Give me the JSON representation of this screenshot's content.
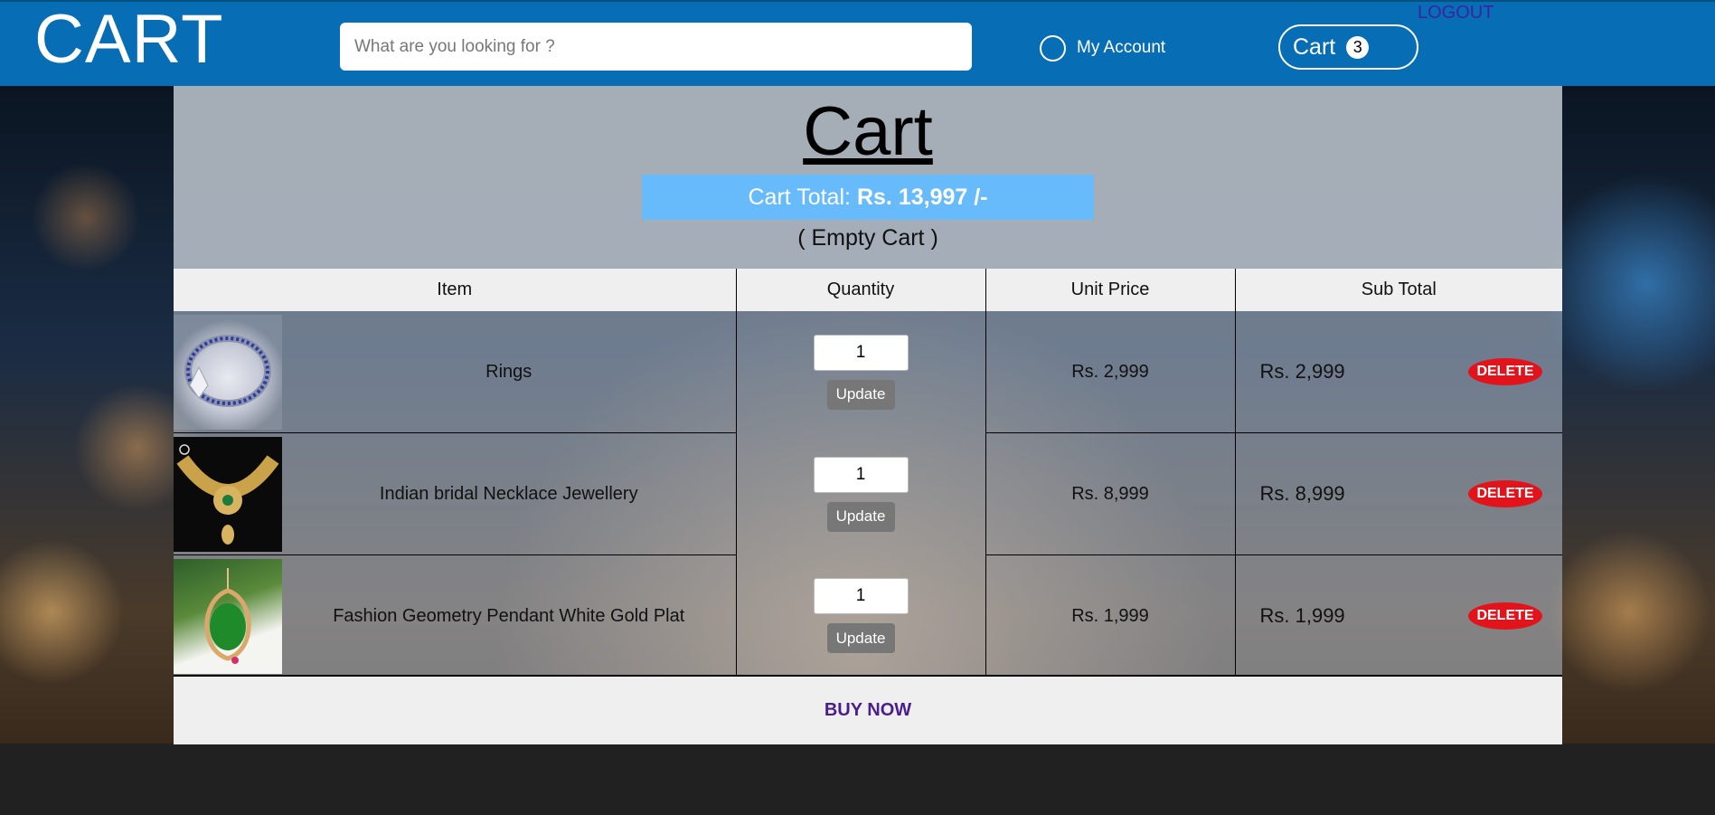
{
  "header": {
    "logo": "CART",
    "search_placeholder": "What are you looking for ?",
    "account_label": "My Account",
    "cart_label": "Cart",
    "cart_count": "3",
    "logout_label": "LOGOUT"
  },
  "main": {
    "title": "Cart",
    "total_label": "Cart Total:",
    "total_value": "Rs. 13,997 /-",
    "empty_note": "( Empty Cart )",
    "columns": [
      "Item",
      "Quantity",
      "Unit Price",
      "Sub Total"
    ],
    "items": [
      {
        "name": "Rings",
        "quantity": "1",
        "unit_price": "Rs. 2,999",
        "sub_total": "Rs. 2,999",
        "image": "ring-image"
      },
      {
        "name": "Indian bridal Necklace Jewellery",
        "quantity": "1",
        "unit_price": "Rs. 8,999",
        "sub_total": "Rs. 8,999",
        "image": "necklace-image"
      },
      {
        "name": "Fashion Geometry Pendant White Gold Plat",
        "quantity": "1",
        "unit_price": "Rs. 1,999",
        "sub_total": "Rs. 1,999",
        "image": "pendant-image"
      }
    ],
    "update_label": "Update",
    "delete_label": "DELETE",
    "buy_now_label": "BUY NOW"
  },
  "colors": {
    "header_bg": "#076db4",
    "total_bar_bg": "#67bbfb",
    "delete_bg": "#e3131b",
    "buy_now": "#4a1f8c",
    "logout": "#3b23a3"
  }
}
